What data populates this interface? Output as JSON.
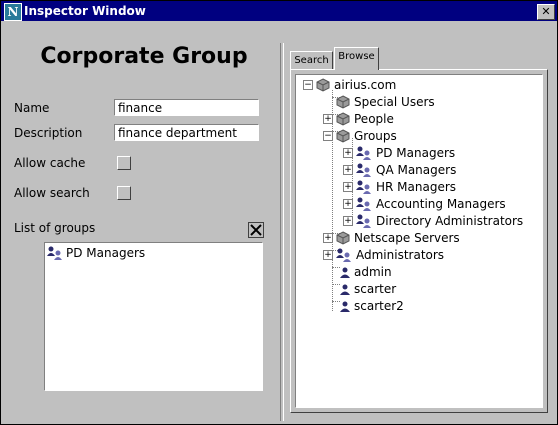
{
  "window": {
    "title": "Inspector Window",
    "app_icon": "N",
    "close_label": "✕"
  },
  "form": {
    "heading": "Corporate Group",
    "name_label": "Name",
    "name_value": "finance",
    "description_label": "Description",
    "description_value": "finance department",
    "allow_cache_label": "Allow cache",
    "allow_search_label": "Allow search",
    "list_of_groups_label": "List of groups",
    "groups": [
      "PD Managers"
    ]
  },
  "tabs": {
    "search": "Search",
    "browse": "Browse",
    "active": "browse"
  },
  "tree": {
    "root": "airius.com",
    "special_users": "Special Users",
    "people": "People",
    "groups": "Groups",
    "group_items": [
      "PD Managers",
      "QA Managers",
      "HR Managers",
      "Accounting Managers",
      "Directory Administrators"
    ],
    "netscape_servers": "Netscape Servers",
    "administrators": "Administrators",
    "users": [
      "admin",
      "scarter",
      "scarter2"
    ]
  },
  "colors": {
    "title_bar": "#000080",
    "window_bg": "#c0c0c0",
    "cube": "#9a9a9a",
    "group_icon": "#2a2a6a"
  }
}
